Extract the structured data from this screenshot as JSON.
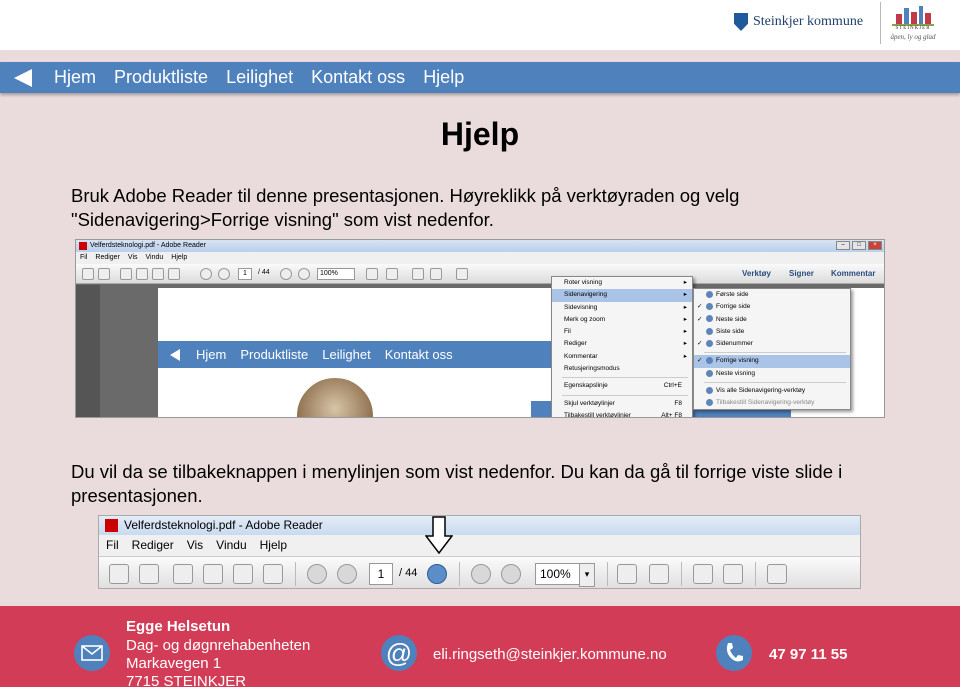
{
  "header": {
    "kommune_logo": "Steinkjer kommune",
    "steinkjer_logo_name": "STEINKJER",
    "steinkjer_logo_slogan": "åpen, ly og glad"
  },
  "nav": {
    "items": [
      "Hjem",
      "Produktliste",
      "Leilighet",
      "Kontakt oss",
      "Hjelp"
    ]
  },
  "title": "Hjelp",
  "paragraph1": "Bruk Adobe Reader til denne presentasjonen. Høyreklikk på verktøyraden og velg \"Sidenavigering>Forrige visning\" som vist nedenfor.",
  "paragraph2": "Du vil da se tilbakeknappen i menylinjen som vist nedenfor. Du kan da gå til forrige viste slide i presentasjonen.",
  "screenshot1": {
    "window_title": "Velferdsteknologi.pdf - Adobe Reader",
    "menu": [
      "Fil",
      "Rediger",
      "Vis",
      "Vindu",
      "Hjelp"
    ],
    "page_num": "1",
    "page_total": "/ 44",
    "zoom": "100%",
    "toolbar_right": [
      "Verktøy",
      "Signer",
      "Kommentar"
    ],
    "page_nav": [
      "Hjem",
      "Produktliste",
      "Leilighet",
      "Kontakt oss"
    ],
    "context_menu": [
      {
        "label": "Roter visning",
        "arrow": true
      },
      {
        "label": "Sidenavigering",
        "arrow": true,
        "highlight": true
      },
      {
        "label": "Sidevisning",
        "arrow": true
      },
      {
        "label": "Merk og zoom",
        "arrow": true
      },
      {
        "label": "Fil",
        "arrow": true
      },
      {
        "label": "Rediger",
        "arrow": true
      },
      {
        "label": "Kommentar",
        "arrow": true
      },
      {
        "label": "Retusjeringsmodus"
      },
      {
        "sep": true
      },
      {
        "label": "Egenskapslinje",
        "shortcut": "Ctrl+E"
      },
      {
        "sep": true
      },
      {
        "label": "Skjul verktøylinjer",
        "shortcut": "F8"
      },
      {
        "label": "Tilbakestill verktøylinjer",
        "shortcut": "Alt+ F8"
      }
    ],
    "submenu": [
      {
        "label": "Første side"
      },
      {
        "label": "Forrige side",
        "check": true
      },
      {
        "label": "Neste side",
        "check": true
      },
      {
        "label": "Siste side"
      },
      {
        "label": "Sidenummer",
        "check": true
      },
      {
        "sep": true
      },
      {
        "label": "Forrige visning",
        "check": true,
        "highlight": true
      },
      {
        "label": "Neste visning"
      },
      {
        "sep": true
      },
      {
        "label": "Vis alle Sidenavigering-verktøy"
      },
      {
        "label": "Tilbakestill Sidenavigering-verktøy",
        "dim": true
      }
    ]
  },
  "screenshot2": {
    "window_title": "Velferdsteknologi.pdf - Adobe Reader",
    "menu": [
      "Fil",
      "Rediger",
      "Vis",
      "Vindu",
      "Hjelp"
    ],
    "page_num": "1",
    "page_total": "/ 44",
    "zoom": "100%"
  },
  "footer": {
    "name": "Egge Helsetun",
    "org": "Dag- og døgnrehabenheten",
    "street": "Markavegen 1",
    "city": "7715 STEINKJER",
    "email": "eli.ringseth@steinkjer.kommune.no",
    "phone": "47 97 11 55"
  },
  "colors": {
    "nav_blue": "#4f81bd",
    "footer_red": "#d33c56",
    "background": "#eadcdd"
  },
  "icons": {
    "back": "back-arrow-icon",
    "mail": "envelope-icon",
    "at": "at-sign-icon",
    "phone": "phone-icon",
    "pointer": "down-arrow-icon"
  }
}
